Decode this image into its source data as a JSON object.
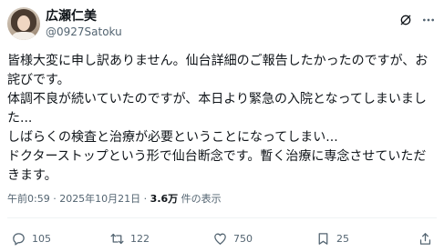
{
  "author": {
    "name": "広瀬仁美",
    "handle": "@0927Satoku"
  },
  "post": {
    "lines": [
      "皆様大変に申し訳ありません。仙台詳細のご報告したかったのですが、お",
      "詫びです。",
      "体調不良が続いていたのですが、本日より緊急の入院となってしまいまし",
      "た...",
      "しばらくの検査と治療が必要ということになってしまい...",
      "ドクターストップという形で仙台断念です。暫く治療に専念させていただ",
      "きます。"
    ]
  },
  "meta": {
    "timestamp": "午前0:59 · 2025年10月21日 · ",
    "views_count": "3.6万",
    "views_label": " 件の表示"
  },
  "actions": {
    "reply_count": "105",
    "retweet_count": "122",
    "like_count": "750",
    "bookmark_count": "25"
  },
  "icons": {
    "grok": "grok-icon",
    "more": "more-icon",
    "reply": "reply-icon",
    "retweet": "retweet-icon",
    "like": "heart-icon",
    "bookmark": "bookmark-icon",
    "share": "share-icon"
  },
  "colors": {
    "text": "#0f1419",
    "secondary": "#536471",
    "divider": "#eff3f4"
  }
}
